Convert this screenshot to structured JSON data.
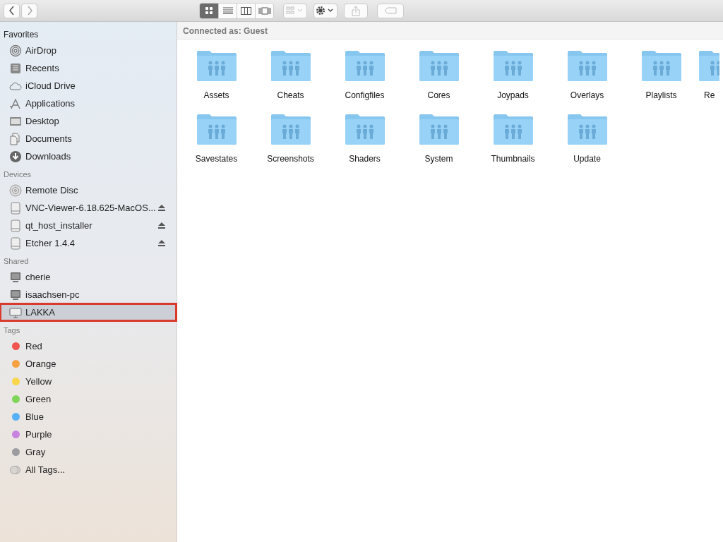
{
  "toolbar": {
    "view_modes": [
      {
        "kind": "icons",
        "selected": true
      },
      {
        "kind": "list",
        "selected": false
      },
      {
        "kind": "columns",
        "selected": false
      },
      {
        "kind": "gallery",
        "selected": false
      }
    ]
  },
  "sidebar": {
    "sections": [
      {
        "title": "Favorites",
        "items": [
          {
            "label": "AirDrop",
            "kind": "airdrop",
            "selected": false,
            "highlighted": false,
            "ejectable": false
          },
          {
            "label": "Recents",
            "kind": "recents",
            "selected": false,
            "highlighted": false,
            "ejectable": false
          },
          {
            "label": "iCloud Drive",
            "kind": "cloud",
            "selected": false,
            "highlighted": false,
            "ejectable": false
          },
          {
            "label": "Applications",
            "kind": "apps",
            "selected": false,
            "highlighted": false,
            "ejectable": false
          },
          {
            "label": "Desktop",
            "kind": "desktop",
            "selected": false,
            "highlighted": false,
            "ejectable": false
          },
          {
            "label": "Documents",
            "kind": "documents",
            "selected": false,
            "highlighted": false,
            "ejectable": false
          },
          {
            "label": "Downloads",
            "kind": "downloads",
            "selected": false,
            "highlighted": false,
            "ejectable": false
          }
        ]
      },
      {
        "title": "Devices",
        "items": [
          {
            "label": "Remote Disc",
            "kind": "disc",
            "selected": false,
            "highlighted": false,
            "ejectable": false
          },
          {
            "label": "VNC-Viewer-6.18.625-MacOS...",
            "kind": "drive",
            "selected": false,
            "highlighted": false,
            "ejectable": true
          },
          {
            "label": "qt_host_installer",
            "kind": "drive",
            "selected": false,
            "highlighted": false,
            "ejectable": true
          },
          {
            "label": "Etcher 1.4.4",
            "kind": "drive",
            "selected": false,
            "highlighted": false,
            "ejectable": true
          }
        ]
      },
      {
        "title": "Shared",
        "items": [
          {
            "label": "cherie",
            "kind": "computer",
            "selected": false,
            "highlighted": false,
            "ejectable": false
          },
          {
            "label": "isaachsen-pc",
            "kind": "computer",
            "selected": false,
            "highlighted": false,
            "ejectable": false
          },
          {
            "label": "LAKKA",
            "kind": "monitor",
            "selected": true,
            "highlighted": true,
            "ejectable": false
          }
        ]
      }
    ],
    "tags": {
      "title": "Tags",
      "items": [
        {
          "label": "Red",
          "color": "#f0564f"
        },
        {
          "label": "Orange",
          "color": "#f5a142"
        },
        {
          "label": "Yellow",
          "color": "#f9d64b"
        },
        {
          "label": "Green",
          "color": "#7ed55a"
        },
        {
          "label": "Blue",
          "color": "#56b1f7"
        },
        {
          "label": "Purple",
          "color": "#c883e0"
        },
        {
          "label": "Gray",
          "color": "#9c9c9e"
        }
      ],
      "all_label": "All Tags..."
    }
  },
  "content": {
    "header": "Connected as: Guest",
    "folders": [
      {
        "name": "Assets",
        "cut": false
      },
      {
        "name": "Cheats",
        "cut": false
      },
      {
        "name": "Configfiles",
        "cut": false
      },
      {
        "name": "Cores",
        "cut": false
      },
      {
        "name": "Joypads",
        "cut": false
      },
      {
        "name": "Overlays",
        "cut": false
      },
      {
        "name": "Playlists",
        "cut": false
      },
      {
        "name": "Re",
        "cut": true
      },
      {
        "name": "Savestates",
        "cut": false
      },
      {
        "name": "Screenshots",
        "cut": false
      },
      {
        "name": "Shaders",
        "cut": false
      },
      {
        "name": "System",
        "cut": false
      },
      {
        "name": "Thumbnails",
        "cut": false
      },
      {
        "name": "Update",
        "cut": false
      }
    ]
  }
}
